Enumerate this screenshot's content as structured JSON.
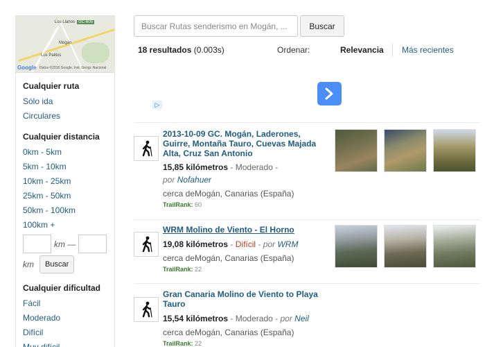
{
  "map": {
    "town1": "Los Llanos",
    "town2": "Mogán",
    "town3": "Los Palitos",
    "logo": "Google",
    "copyright": "Datos ©2016 Google, Inst. Geogr. Nacional"
  },
  "sidebar": {
    "route_type": {
      "title": "Cualquier ruta",
      "options": [
        "Sólo ida",
        "Circulares"
      ]
    },
    "distance": {
      "title": "Cualquier distancia",
      "options": [
        "0km - 5km",
        "5km - 10km",
        "10km - 25km",
        "25km - 50km",
        "50km - 100km",
        "100km +"
      ],
      "range_sep": "km —",
      "range_unit": "km",
      "search_label": "Buscar"
    },
    "difficulty": {
      "title": "Cualquier dificultad",
      "options": [
        "Fácil",
        "Moderado",
        "Difícil",
        "Muy difícil"
      ]
    }
  },
  "search": {
    "placeholder": "Buscar Rutas senderismo en Mogán, ...",
    "button": "Buscar"
  },
  "results_header": {
    "count": "18 resultados",
    "time": "(0.003s)",
    "sort_label": "Ordenar:",
    "sort_relevance": "Relevancia",
    "sort_recent": "Más recientes"
  },
  "ad": {
    "marker": "▷"
  },
  "results": [
    {
      "title": "2013-10-09 GC. Mogán, Laderones, Guirre, Montaña Tauro, Cuevas Majada Alta, Cruz San Antonio",
      "distance": "15,85 kilómetros",
      "difficulty": "Moderado",
      "by": "por",
      "author": "Nofahuer",
      "location": "cerca deMogán, Canarias (España)",
      "trailrank_label": "TrailRank:",
      "trailrank": "60"
    },
    {
      "title": "WRM Molino de Viento - El Horno",
      "distance": "19,08 kilómetros",
      "difficulty": "Difícil",
      "by": "por",
      "author": "WRM",
      "location": "cerca deMogán, Canarias (España)",
      "trailrank_label": "TrailRank:",
      "trailrank": "22"
    },
    {
      "title": "Gran Canaria Molino de Viento to Playa Tauro",
      "distance": "15,54 kilómetros",
      "difficulty": "Moderado",
      "by": "por",
      "author": "Neil",
      "location": "cerca deMogán, Canarias (España)",
      "trailrank_label": "TrailRank:",
      "trailrank": "22"
    }
  ],
  "colors": {
    "link": "#1f5c82",
    "hard": "#c23b22",
    "trailrank": "#3a7a2c",
    "next_button": "#4c8ef7"
  }
}
